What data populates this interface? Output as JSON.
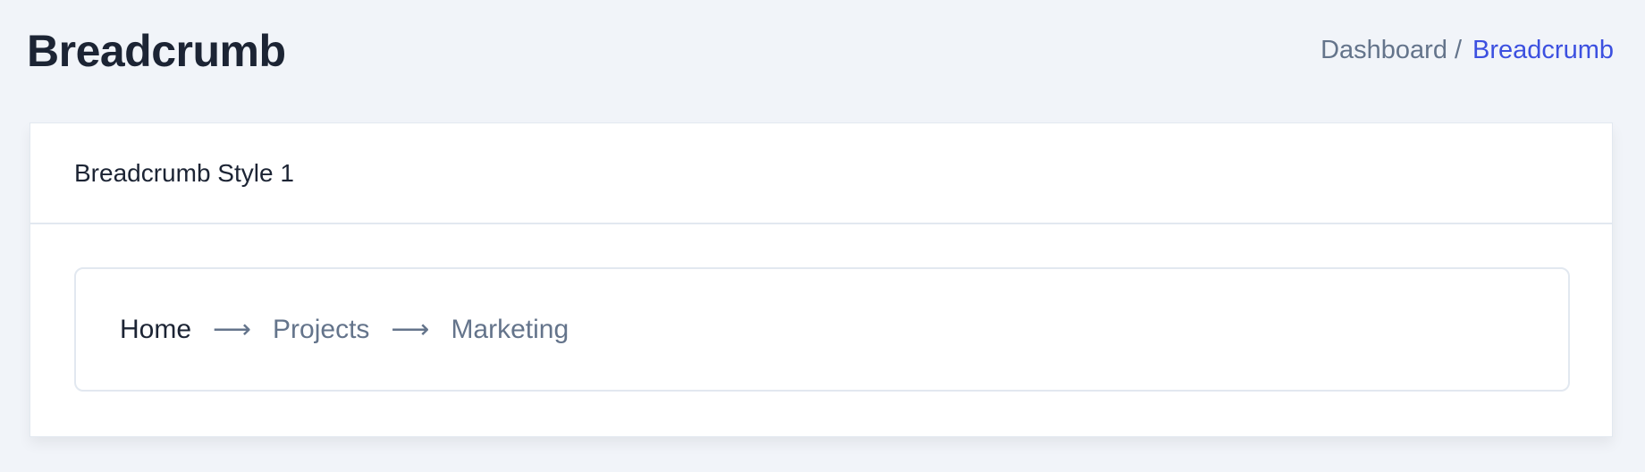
{
  "header": {
    "title": "Breadcrumb",
    "breadcrumb": {
      "items": [
        "Dashboard",
        "Breadcrumb"
      ],
      "separator": "/"
    }
  },
  "card": {
    "title": "Breadcrumb Style 1",
    "breadcrumb": {
      "items": [
        "Home",
        "Projects",
        "Marketing"
      ],
      "separator_icon": "arrow-right-icon",
      "separator": "⟶"
    }
  },
  "colors": {
    "background": "#f1f4f9",
    "accent": "#3c50e0",
    "text_dark": "#1c2434",
    "text_muted": "#64748b"
  }
}
